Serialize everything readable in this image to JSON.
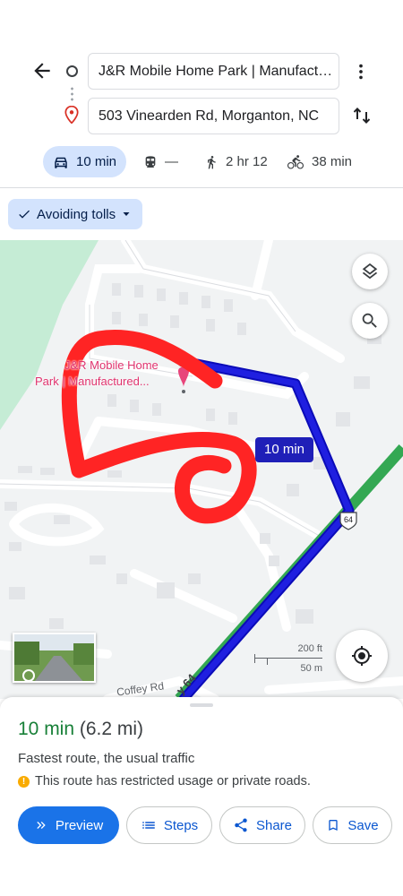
{
  "header": {
    "origin": "J&R Mobile Home Park | Manufactured Home Community",
    "destination": "503 Vinearden Rd, Morganton, NC",
    "icons": [
      "back-arrow-icon",
      "origin-circle-icon",
      "destination-pin-icon",
      "more-vert-icon",
      "swap-icon"
    ]
  },
  "modes": {
    "drive": "10 min",
    "transit": "—",
    "walk": "2 hr 12",
    "bike": "38 min"
  },
  "filter": {
    "label": "Avoiding tolls"
  },
  "map": {
    "place_label_line1": "J&R Mobile Home",
    "place_label_line2": "Park | Manufactured...",
    "route_time": "10 min",
    "road_shield": "64",
    "road_label_1": "Coffey Rd",
    "road_label_2": "y 64",
    "scale_ft": "200 ft",
    "scale_m": "50 m",
    "colors": {
      "route": "#1f1fe0",
      "annotation": "#ff2424",
      "highway": "#34a853"
    }
  },
  "sheet": {
    "time": "10 min",
    "distance": "(6.2 mi)",
    "description": "Fastest route, the usual traffic",
    "warning": "This route has restricted usage or private roads.",
    "buttons": {
      "preview": "Preview",
      "steps": "Steps",
      "share": "Share",
      "save": "Save"
    }
  }
}
